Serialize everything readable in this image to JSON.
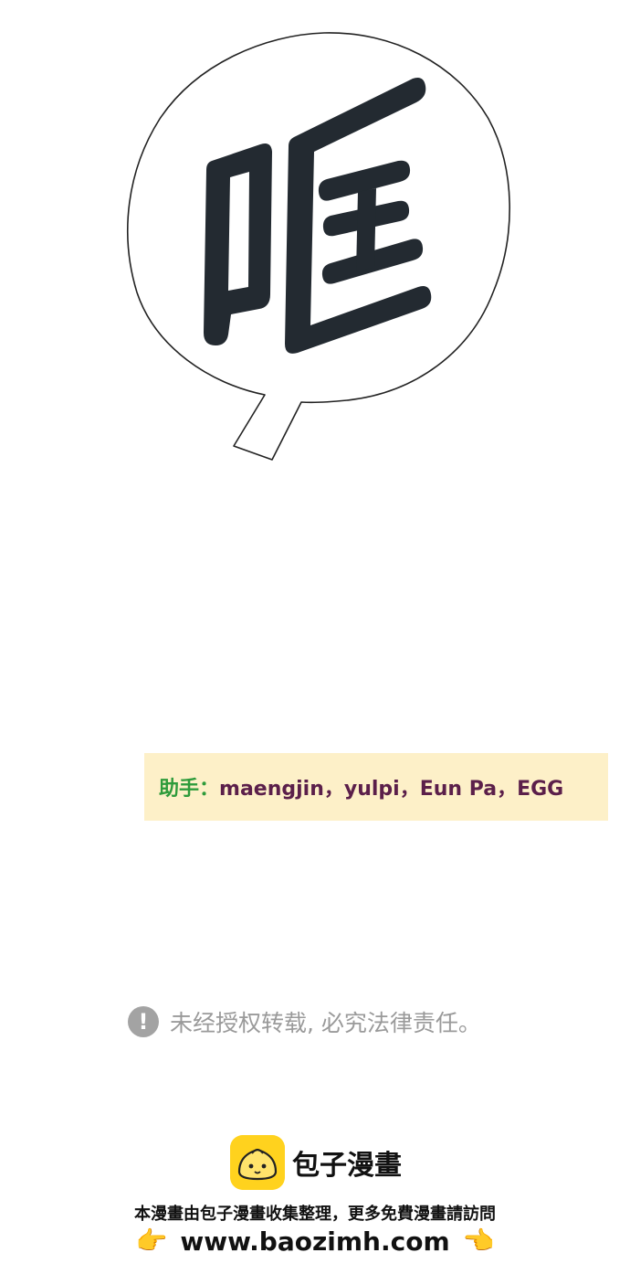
{
  "speech_bubble": {
    "glyph": "哐"
  },
  "credits": {
    "label": "助手：",
    "names": "maengjin，yulpi，Eun Pa，EGG"
  },
  "notice": {
    "icon": "exclamation-icon",
    "text": "未经授权转载, 必究法律责任。"
  },
  "footer": {
    "brand_name": "包子漫畫",
    "promo_text": "本漫畫由包子漫畫收集整理，更多免費漫畫請訪問",
    "url": "www.baozimh.com",
    "hand_left": "👉",
    "hand_right": "👈",
    "logo_color": "#ffd21e"
  }
}
